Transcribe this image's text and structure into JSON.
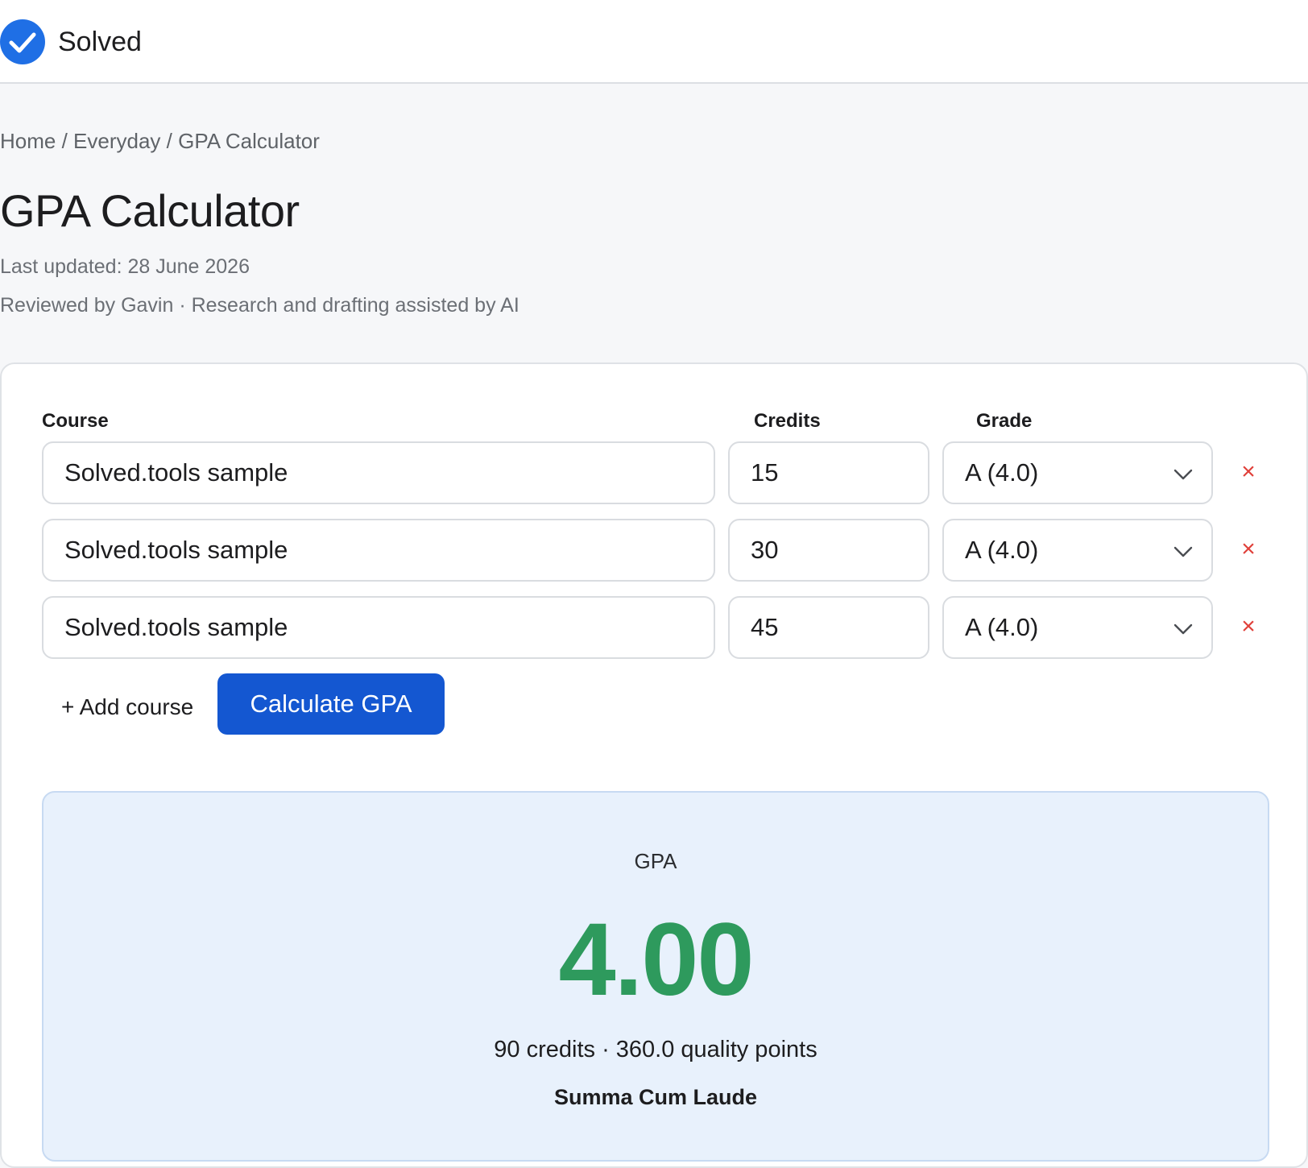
{
  "header": {
    "brand": "Solved",
    "logo_icon": "check-circle-icon",
    "accent_color": "#1f6fe5"
  },
  "breadcrumb": {
    "items": [
      "Home",
      "Everyday",
      "GPA Calculator"
    ],
    "separator": " / "
  },
  "page": {
    "title": "GPA Calculator",
    "last_updated": "Last updated: 28 June 2026",
    "review_line": "Reviewed by Gavin · Research and drafting assisted by AI"
  },
  "calculator": {
    "columns": {
      "course": "Course",
      "credits": "Credits",
      "grade": "Grade"
    },
    "rows": [
      {
        "course": "Solved.tools sample",
        "credits": "15",
        "grade": "A (4.0)",
        "remove": "×"
      },
      {
        "course": "Solved.tools sample",
        "credits": "30",
        "grade": "A (4.0)",
        "remove": "×"
      },
      {
        "course": "Solved.tools sample",
        "credits": "45",
        "grade": "A (4.0)",
        "remove": "×"
      }
    ],
    "add_course_label": "+ Add course",
    "calculate_label": "Calculate GPA",
    "button_color": "#1457d1",
    "remove_color": "#e0403a"
  },
  "result": {
    "label": "GPA",
    "value": "4.00",
    "detail": "90 credits · 360.0 quality points",
    "honor": "Summa Cum Laude",
    "value_color": "#2e9a5d",
    "background_color": "#e8f1fc"
  }
}
